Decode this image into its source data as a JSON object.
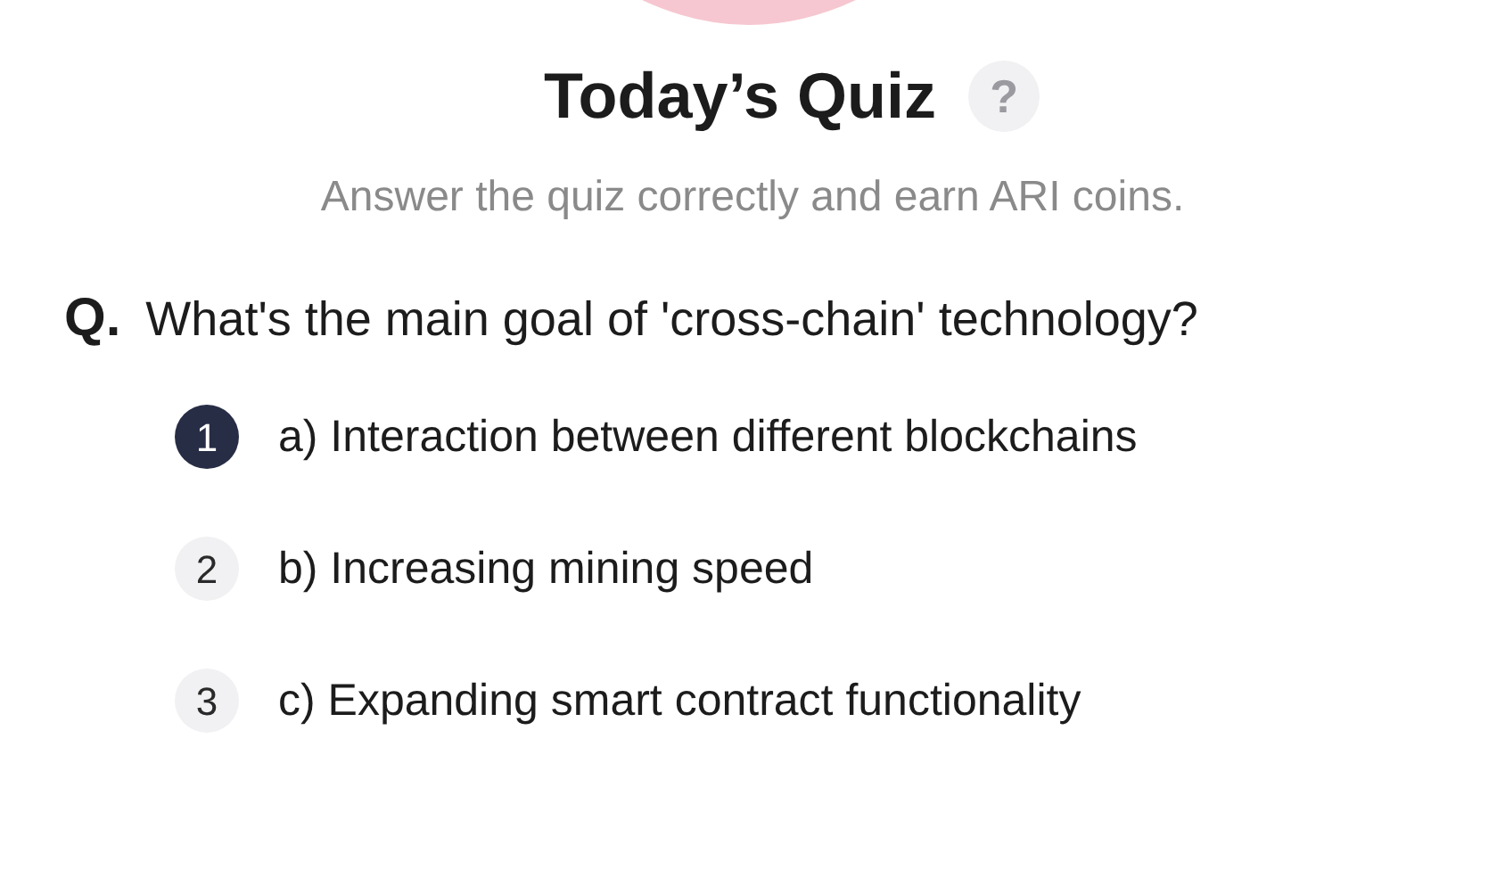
{
  "title": "Today’s Quiz",
  "help_icon": "?",
  "subtitle": "Answer the quiz correctly and earn ARI coins.",
  "question": {
    "prefix": "Q.",
    "text": "What's the main goal of 'cross-chain' technology?"
  },
  "options": [
    {
      "number": "1",
      "text": "a) Interaction between different blockchains",
      "selected": true
    },
    {
      "number": "2",
      "text": "b) Increasing mining speed",
      "selected": false
    },
    {
      "number": "3",
      "text": "c) Expanding smart contract functionality",
      "selected": false
    }
  ]
}
